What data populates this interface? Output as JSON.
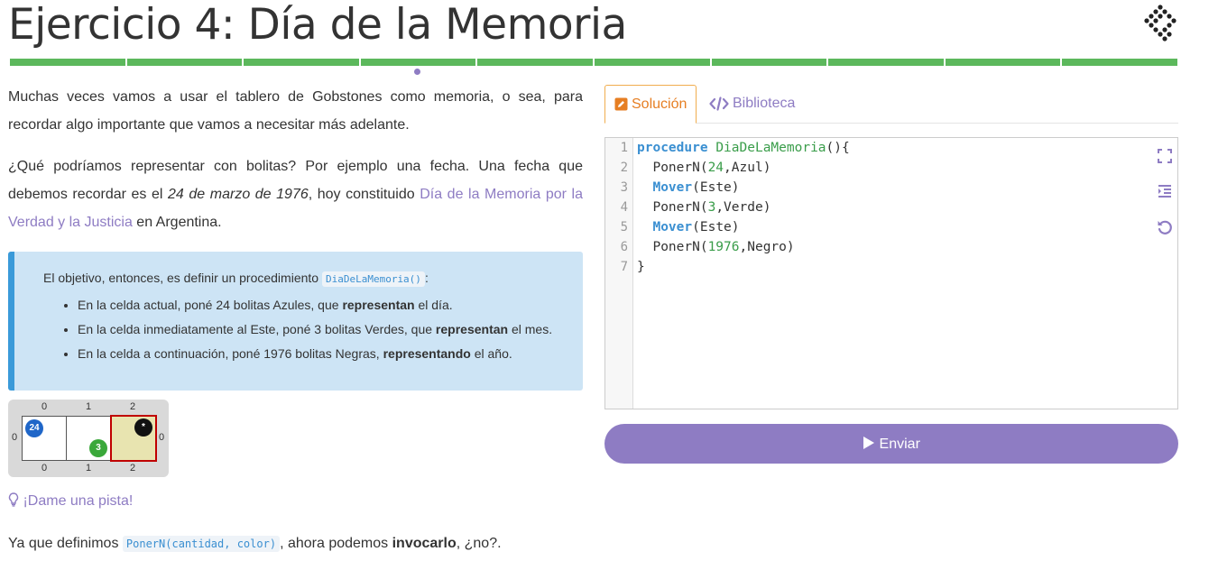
{
  "header": {
    "title": "Ejercicio 4: Día de la Memoria"
  },
  "progress": {
    "segments": 10,
    "color": "#5cb85c",
    "current_marker_color": "#8e7cc3"
  },
  "description": {
    "p1": "Muchas veces vamos a usar el tablero de Gobstones como memoria, o sea, para recordar algo importante que vamos a necesitar más adelante.",
    "p2_before": "¿Qué podríamos representar con bolitas? Por ejemplo una fecha. Una fecha que debemos recordar es el ",
    "p2_em": "24 de marzo de 1976",
    "p2_mid": ", hoy constituido ",
    "p2_link": "Día de la Memoria por la Verdad y la Justicia",
    "p2_after": " en Argentina."
  },
  "callout": {
    "intro_before": "El objetivo, entonces, es definir un procedimiento ",
    "intro_code": "DiaDeLaMemoria()",
    "intro_after": ":",
    "items": [
      {
        "before": "En la celda actual, poné 24 bolitas Azules, que ",
        "bold": "representan",
        "after": " el día."
      },
      {
        "before": "En la celda inmediatamente al Este, poné 3 bolitas Verdes, que ",
        "bold": "representan",
        "after": " el mes."
      },
      {
        "before": "En la celda a continuación, poné 1976 bolitas Negras, ",
        "bold": "representando",
        "after": " el año."
      }
    ]
  },
  "board": {
    "col_labels": [
      "0",
      "1",
      "2"
    ],
    "row_labels": [
      "0"
    ],
    "cells": [
      {
        "balls": [
          {
            "color": "blue",
            "count": "24"
          }
        ]
      },
      {
        "balls": [
          {
            "color": "green",
            "count": "3"
          }
        ]
      },
      {
        "balls": [
          {
            "color": "black",
            "count": "*"
          }
        ],
        "selected": true
      }
    ]
  },
  "hint": {
    "label": "¡Dame una pista!"
  },
  "footer_text": {
    "before": "Ya que definimos ",
    "code": "PonerN(cantidad, color)",
    "mid": ", ahora podemos ",
    "bold": "invocarlo",
    "after": ", ¿no?."
  },
  "tabs": [
    {
      "label": "Solución",
      "active": true,
      "icon": "edit-icon"
    },
    {
      "label": "Biblioteca",
      "active": false,
      "icon": "code-icon"
    }
  ],
  "editor": {
    "line_numbers": [
      "1",
      "2",
      "3",
      "4",
      "5",
      "6",
      "7"
    ],
    "lines": [
      "procedure DiaDeLaMemoria(){",
      "  PonerN(24,Azul)",
      "  Mover(Este)",
      "  PonerN(3,Verde)",
      "  Mover(Este)",
      "  PonerN(1976,Negro)",
      "}"
    ],
    "tools": [
      "fullscreen-icon",
      "indent-icon",
      "reset-icon"
    ]
  },
  "submit": {
    "label": "Enviar"
  }
}
